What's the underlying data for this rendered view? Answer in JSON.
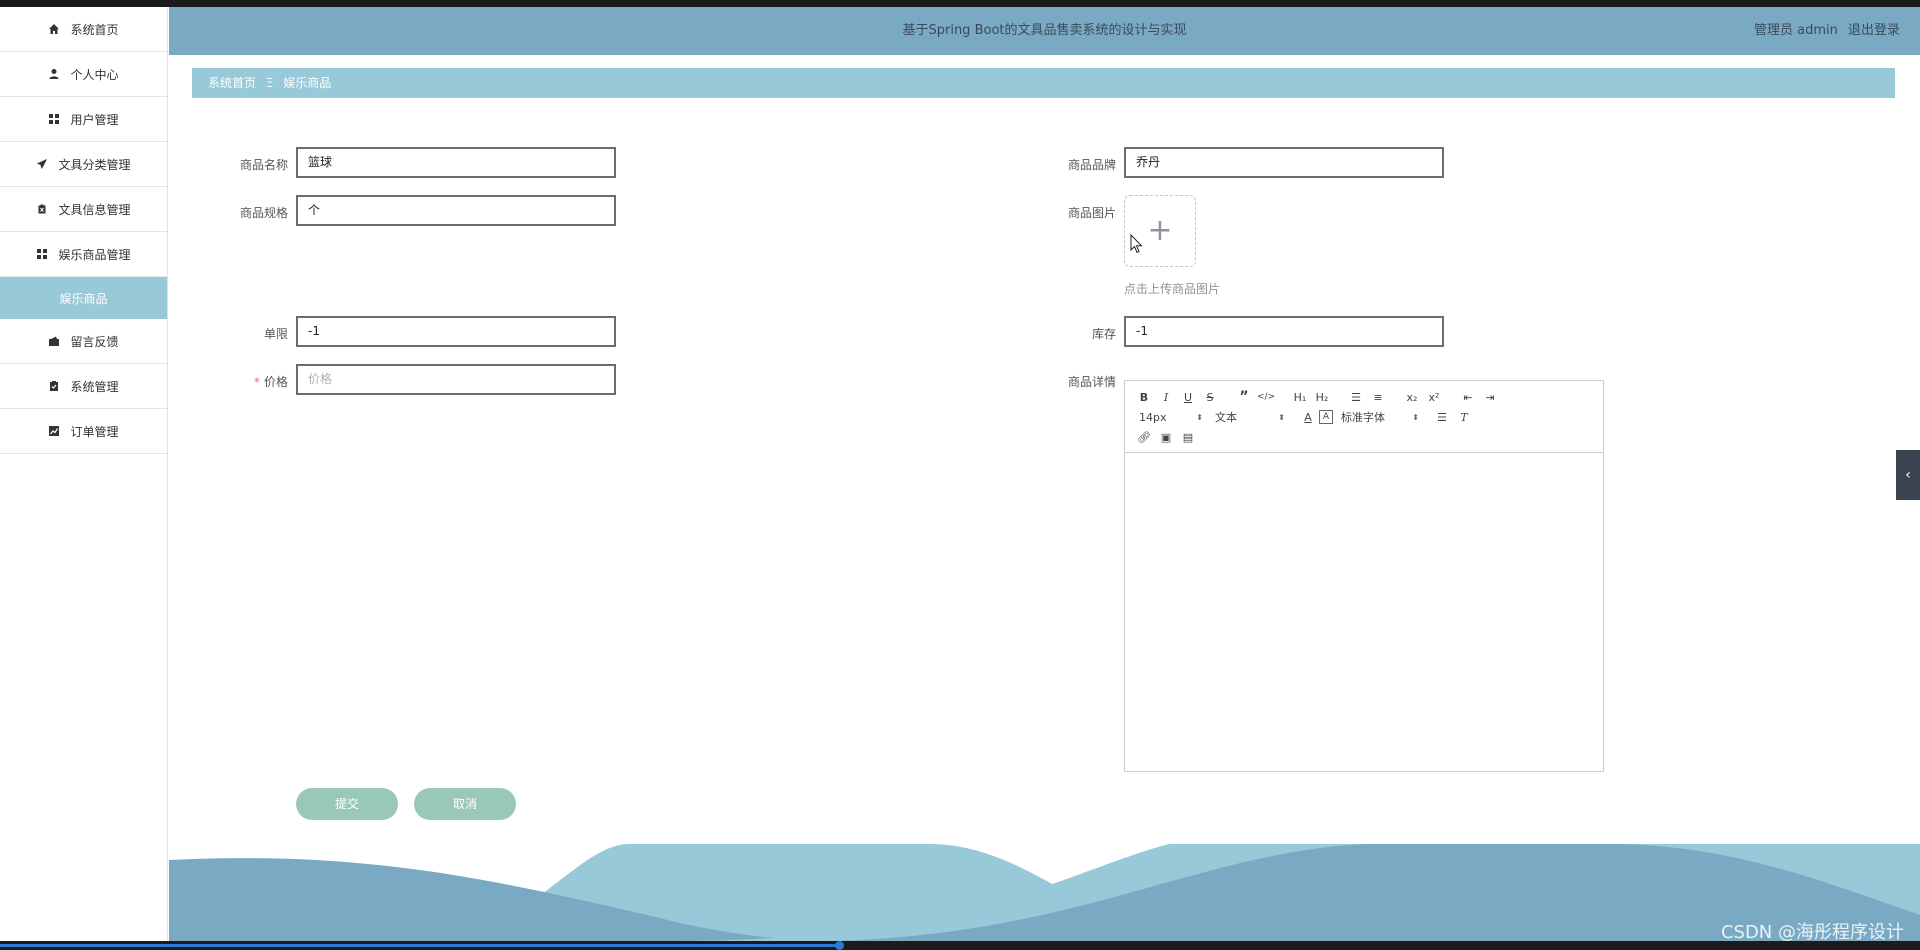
{
  "app": {
    "title": "基于Spring Boot的文具品售卖系统的设计与实现",
    "user_label": "管理员 admin",
    "logout_label": "退出登录"
  },
  "sidebar": {
    "items": [
      {
        "label": "系统首页",
        "icon": "home-icon"
      },
      {
        "label": "个人中心",
        "icon": "person-icon"
      },
      {
        "label": "用户管理",
        "icon": "grid-icon"
      },
      {
        "label": "文具分类管理",
        "icon": "send-icon"
      },
      {
        "label": "文具信息管理",
        "icon": "clipboard-x-icon"
      },
      {
        "label": "娱乐商品管理",
        "icon": "grid-icon"
      },
      {
        "label": "娱乐商品",
        "icon": ""
      },
      {
        "label": "留言反馈",
        "icon": "wallet-icon"
      },
      {
        "label": "系统管理",
        "icon": "clipboard-check-icon"
      },
      {
        "label": "订单管理",
        "icon": "chart-icon"
      }
    ]
  },
  "breadcrumb": {
    "home": "系统首页",
    "separator": "Ξ",
    "current": "娱乐商品"
  },
  "form": {
    "name_label": "商品名称",
    "name_value": "篮球",
    "brand_label": "商品品牌",
    "brand_value": "乔丹",
    "spec_label": "商品规格",
    "spec_value": "个",
    "image_label": "商品图片",
    "upload_hint": "点击上传商品图片",
    "limit_label": "单限",
    "limit_value": "-1",
    "stock_label": "库存",
    "stock_value": "-1",
    "price_required_mark": "*",
    "price_label": "价格",
    "price_placeholder": "价格",
    "detail_label": "商品详情"
  },
  "editor": {
    "font_size": "14px",
    "text_type": "文本",
    "font_family": "标准字体"
  },
  "buttons": {
    "submit": "提交",
    "cancel": "取消"
  },
  "watermark": "CSDN @海彤程序设计",
  "colors": {
    "header": "#7aa9c4",
    "breadcrumb": "#98c9d8",
    "button": "#99c9b6"
  }
}
